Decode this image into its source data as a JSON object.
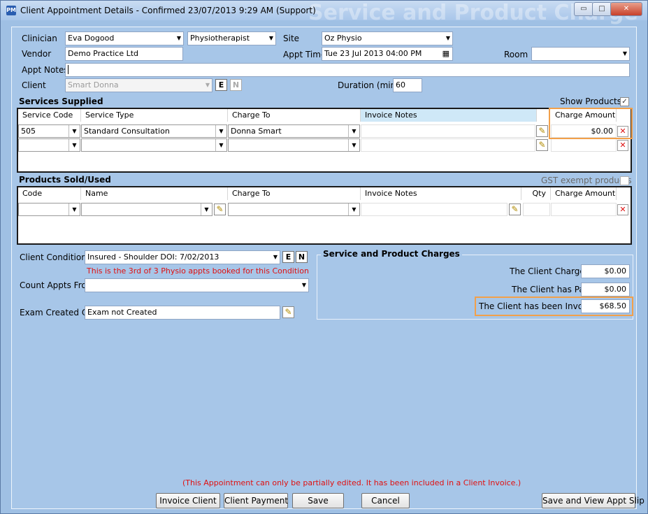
{
  "window": {
    "title": "Client Appointment Details - Confirmed 23/07/2013 9:29 AM (Support)",
    "ghost_title": "Service and Product Charge",
    "app_icon_text": "PM",
    "min_glyph": "▭",
    "max_glyph": "□",
    "close_glyph": "✕"
  },
  "form": {
    "clinician_label": "Clinician",
    "clinician_value": "Eva Dogood",
    "profession_value": "Physiotherapist",
    "site_label": "Site",
    "site_value": "Oz Physio",
    "vendor_label": "Vendor",
    "vendor_value": "Demo Practice Ltd",
    "appt_time_label": "Appt Time",
    "appt_time_value": "Tue  23  Jul  2013 04:00 PM",
    "room_label": "Room",
    "room_value": "",
    "appt_notes_label": "Appt Notes",
    "appt_notes_value": "",
    "client_label": "Client",
    "client_value": "Smart Donna",
    "client_e": "E",
    "client_n": "N",
    "duration_label": "Duration (mins)",
    "duration_value": "60"
  },
  "services": {
    "title": "Services Supplied",
    "show_products_label": "Show Products?",
    "show_products_checked": "✓",
    "columns": [
      "Service Code",
      "Service Type",
      "Charge To",
      "Invoice Notes",
      "Charge Amount"
    ],
    "rows": [
      {
        "code": "505",
        "type": "Standard Consultation",
        "charge_to": "Donna Smart",
        "notes": "",
        "amount": "$0.00"
      },
      {
        "code": "",
        "type": "",
        "charge_to": "",
        "notes": "",
        "amount": ""
      }
    ]
  },
  "products": {
    "title": "Products Sold/Used",
    "gst_label": "GST exempt products",
    "columns": [
      "Code",
      "Name",
      "Charge To",
      "Invoice Notes",
      "Qty",
      "Charge Amount"
    ],
    "rows": [
      {
        "code": "",
        "name": "",
        "charge_to": "",
        "notes": "",
        "qty": "",
        "amount": ""
      }
    ]
  },
  "condition": {
    "label": "Client Condition",
    "value": "Insured -  Shoulder DOI: 7/02/2013",
    "e": "E",
    "n": "N",
    "warning": "This is the 3rd of 3 Physio appts booked for this Condition",
    "count_from_label": "Count Appts From",
    "count_from_value": "",
    "exam_label": "Exam Created On",
    "exam_value": "Exam not Created"
  },
  "charges": {
    "title": "Service and Product Charges",
    "client_charge_label": "The Client Charge is",
    "client_charge_value": "$0.00",
    "client_paid_label": "The Client has Paid",
    "client_paid_value": "$0.00",
    "client_invoiced_label": "The Client has been Invoiced",
    "client_invoiced_value": "$68.50"
  },
  "footer": {
    "notice": "(This Appointment can only be partially edited. It has been included in a Client Invoice.)",
    "invoice_client": "Invoice Client",
    "client_payment": "Client Payment",
    "save": "Save",
    "cancel": "Cancel",
    "save_view_slip": "Save and View Appt Slip"
  },
  "icons": {
    "dropdown": "▼",
    "pencil": "✎",
    "delete": "✕",
    "calendar": "▦"
  },
  "colors": {
    "window_bg": "#a7c6e8",
    "highlight": "#f2a04a",
    "warning_text": "#e01010"
  }
}
